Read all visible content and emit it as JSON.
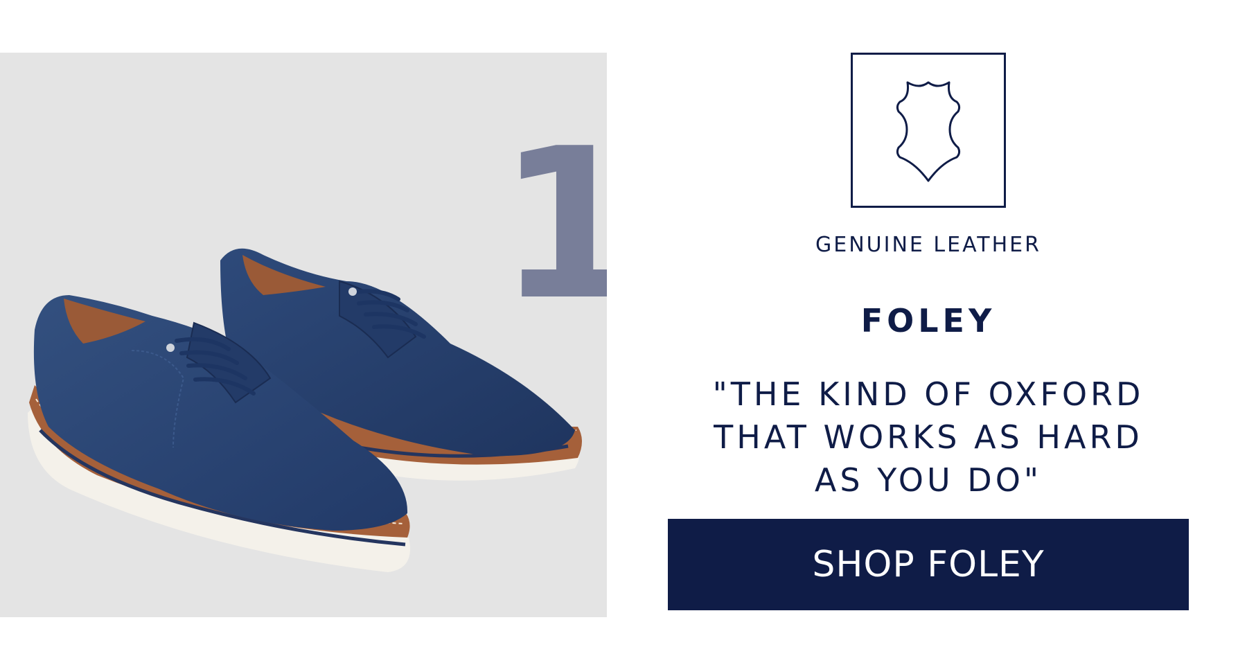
{
  "product_panel": {
    "rank": "1",
    "image_alt": "Navy suede oxford shoes with tan welt and white sole"
  },
  "feature": {
    "icon": "leather-hide-icon",
    "label": "GENUINE LEATHER"
  },
  "product": {
    "name": "FOLEY",
    "quote": "\"THE KIND OF OXFORD THAT WORKS AS HARD AS YOU DO\""
  },
  "cta": {
    "label": "SHOP FOLEY"
  },
  "colors": {
    "navy": "#0f1c47",
    "panel_gray": "#e4e4e4",
    "rank_gray": "#787e99",
    "suede": "#2a4272",
    "tan": "#a5603a",
    "sole": "#f4f1ea"
  }
}
